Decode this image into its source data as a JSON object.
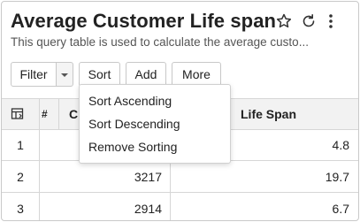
{
  "header": {
    "title": "Average Customer Life span",
    "subtitle": "This query table is used to calculate the average custo..."
  },
  "toolbar": {
    "filter_label": "Filter",
    "sort_label": "Sort",
    "add_label": "Add",
    "more_label": "More"
  },
  "sort_menu": {
    "items": [
      "Sort Ascending",
      "Sort Descending",
      "Remove Sorting"
    ]
  },
  "table": {
    "row_number_header": "#",
    "columns": [
      "C",
      "Life Span"
    ],
    "rows": [
      {
        "num": "1",
        "c": "",
        "life_span": "4.8"
      },
      {
        "num": "2",
        "c": "3217",
        "life_span": "19.7"
      },
      {
        "num": "3",
        "c": "2914",
        "life_span": "6.7"
      }
    ]
  },
  "icons": [
    "star-icon",
    "refresh-icon",
    "more-vertical-icon",
    "chevron-down-icon",
    "column-settings-icon"
  ]
}
